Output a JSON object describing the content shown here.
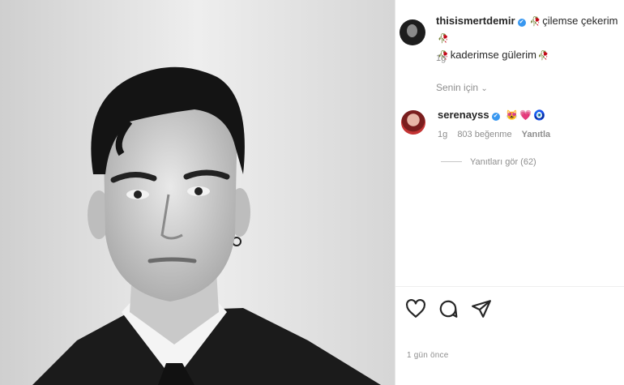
{
  "post": {
    "author": "thisismertdemir",
    "caption_line1": "çilemse çekerim",
    "caption_line2": "kaderimse gülerim",
    "rose_icon": "🥀",
    "verified_icon": "✔",
    "time": "1g"
  },
  "for_you_label": "Senin için",
  "comment": {
    "username": "serenayss",
    "emojis": [
      "😻",
      "💗",
      "🧿"
    ],
    "time": "1g",
    "likes": "803 beğenme",
    "reply_label": "Yanıtla",
    "view_replies": "Yanıtları gör (62)"
  },
  "footer": {
    "time_ago": "1 gün önce"
  },
  "colors": {
    "verified": "#3897f0",
    "secondary_text": "#8e8e8e",
    "primary_text": "#262626"
  },
  "icons": [
    "heart-icon",
    "comment-icon",
    "share-icon",
    "verified-badge-icon",
    "rose-icon",
    "chevron-down-icon"
  ]
}
